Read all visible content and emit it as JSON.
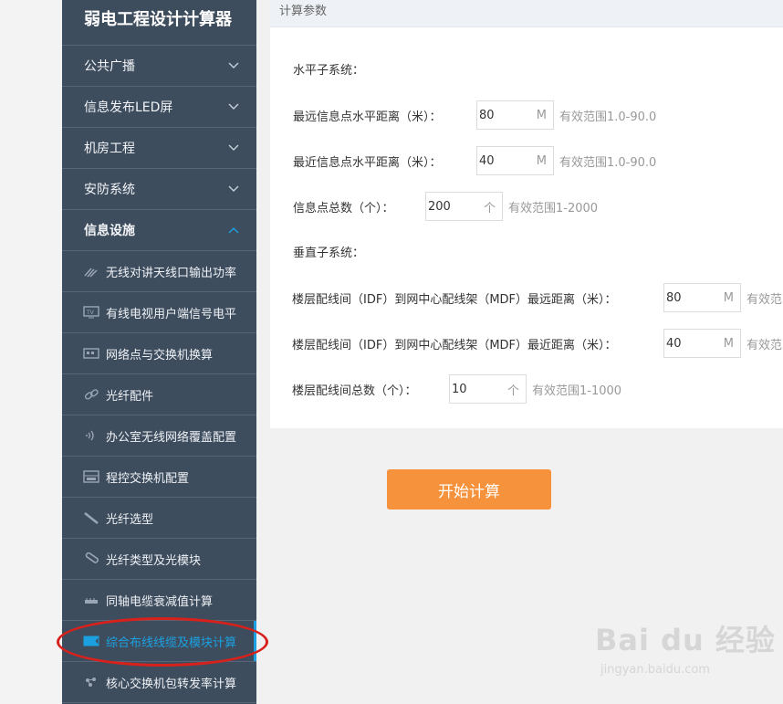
{
  "sidebar": {
    "title": "弱电工程设计计算器",
    "categories": [
      {
        "label": "公共广播"
      },
      {
        "label": "信息发布LED屏"
      },
      {
        "label": "机房工程"
      },
      {
        "label": "安防系统"
      },
      {
        "label": "信息设施"
      }
    ],
    "subitems": [
      {
        "label": "无线对讲天线口输出功率",
        "icon": "antenna-icon"
      },
      {
        "label": "有线电视用户端信号电平",
        "icon": "tv-icon"
      },
      {
        "label": "网络点与交换机换算",
        "icon": "switch-icon"
      },
      {
        "label": "光纤配件",
        "icon": "link-icon"
      },
      {
        "label": "办公室无线网络覆盖配置",
        "icon": "wifi-icon"
      },
      {
        "label": "程控交换机配置",
        "icon": "pbx-icon"
      },
      {
        "label": "光纤选型",
        "icon": "fiber-icon"
      },
      {
        "label": "光纤类型及光模块",
        "icon": "fiber-module-icon"
      },
      {
        "label": "同轴电缆衰减值计算",
        "icon": "coax-icon"
      },
      {
        "label": "综合布线线缆及模块计算",
        "icon": "cabling-icon"
      },
      {
        "label": "核心交换机包转发率计算",
        "icon": "core-switch-icon"
      }
    ],
    "active_index": 9
  },
  "panel": {
    "header": "计算参数",
    "horizontal_title": "水平子系统：",
    "vertical_title": "垂直子系统：",
    "fields": [
      {
        "label": "最远信息点水平距离（米）：",
        "value": "80",
        "unit": "M",
        "hint": "有效范围1.0-90.0"
      },
      {
        "label": "最近信息点水平距离（米）：",
        "value": "40",
        "unit": "M",
        "hint": "有效范围1.0-90.0"
      },
      {
        "label": "信息点总数（个）：",
        "value": "200",
        "unit": "个",
        "hint": "有效范围1-2000"
      },
      {
        "label": "楼层配线间（IDF）到网中心配线架（MDF）最远距离（米）：",
        "value": "80",
        "unit": "M",
        "hint": "有效范"
      },
      {
        "label": "楼层配线间（IDF）到网中心配线架（MDF）最近距离（米）：",
        "value": "40",
        "unit": "M",
        "hint": "有效范"
      },
      {
        "label": "楼层配线间总数（个）：",
        "value": "10",
        "unit": "个",
        "hint": "有效范围1-1000"
      }
    ]
  },
  "button": {
    "label": "开始计算"
  },
  "watermark": {
    "brand": "Bai du 经验",
    "url": "jingyan.baidu.com"
  },
  "colors": {
    "sidebar_bg": "#3e4d5e",
    "accent": "#1ba1e2",
    "button": "#f6923b",
    "highlight": "#d9211c"
  }
}
